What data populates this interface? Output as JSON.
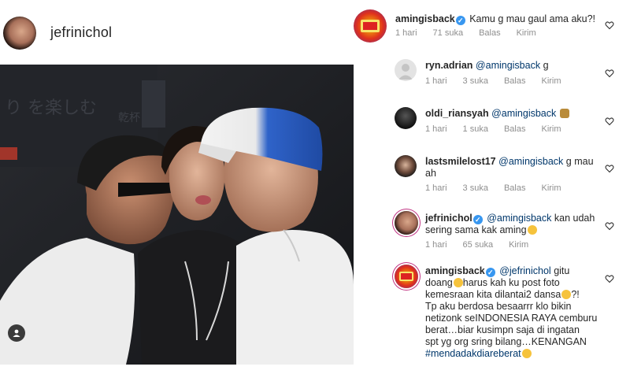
{
  "post": {
    "username": "jefrinichol",
    "avatar_icon": "profile-avatar",
    "tag_icon": "user-tag-icon"
  },
  "comments": [
    {
      "user": "amingisback",
      "verified": true,
      "text": "Kamu g mau gaul ama aku?!",
      "time": "1 hari",
      "likes": "71 suka",
      "reply": "Balas",
      "send": "Kirim"
    },
    {
      "user": "ryn.adrian",
      "mention": "@amingisback",
      "text": "g",
      "time": "1 hari",
      "likes": "3 suka",
      "reply": "Balas",
      "send": "Kirim"
    },
    {
      "user": "oldi_riansyah",
      "mention": "@amingisback",
      "text": "",
      "time": "1 hari",
      "likes": "1 suka",
      "reply": "Balas",
      "send": "Kirim"
    },
    {
      "user": "lastsmilelost17",
      "mention": "@amingisback",
      "text_line1": "g mau",
      "text_line2": "ah",
      "time": "1 hari",
      "likes": "3 suka",
      "reply": "Balas",
      "send": "Kirim"
    },
    {
      "user": "jefrinichol",
      "verified": true,
      "mention": "@amingisback",
      "text_line1": "kan udah",
      "text_line2": "sering sama kak aming",
      "time": "1 hari",
      "likes": "65 suka",
      "send": "Kirim"
    },
    {
      "user": "amingisback",
      "verified": true,
      "mention": "@jefrinichol",
      "line1": "gitu",
      "line2": "doang",
      "line2b": "harus kah ku post foto",
      "line3": "kemesraan kita dilantai2 dansa",
      "line3b": "?!",
      "line4": "Tp aku berdosa besaarrr klo bikin",
      "line5": "netizonk seINDONESIA RAYA cemburu",
      "line6": "berat…biar kusimpn saja di ingatan",
      "line7": "spt yg org sring bilang…KENANGAN",
      "hashtag": "#mendadakdiareberat"
    }
  ],
  "colors": {
    "text": "#262626",
    "meta": "#8e8e8e",
    "mention": "#00376b",
    "verified": "#3897f0"
  }
}
